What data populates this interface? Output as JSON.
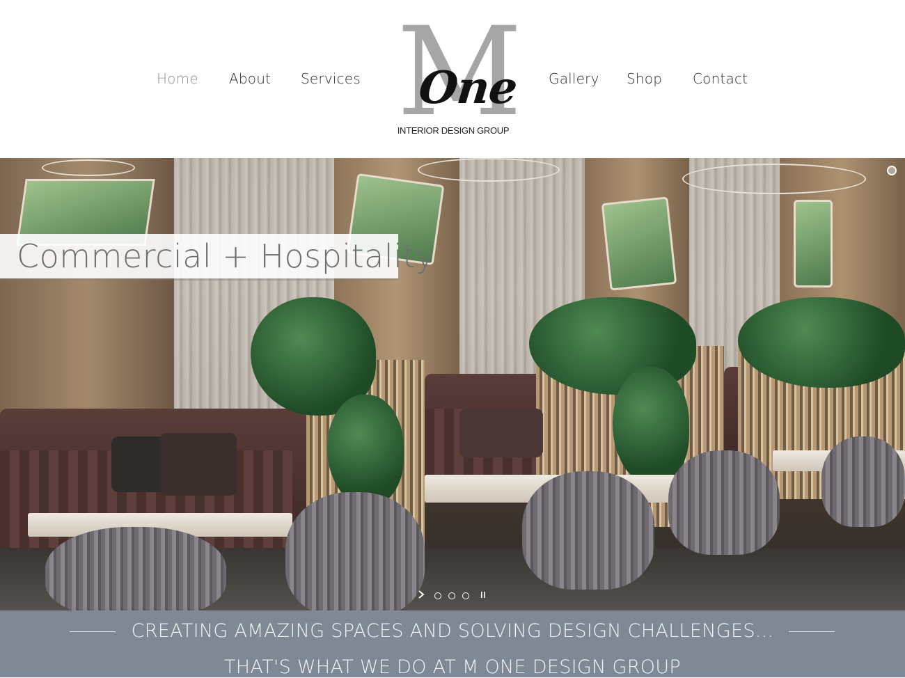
{
  "nav": {
    "left": [
      {
        "label": "Home",
        "active": true
      },
      {
        "label": "About",
        "active": false
      },
      {
        "label": "Services",
        "active": false
      }
    ],
    "right": [
      {
        "label": "Gallery",
        "active": false
      },
      {
        "label": "Shop",
        "active": false
      },
      {
        "label": "Contact",
        "active": false
      }
    ]
  },
  "logo": {
    "letter": "M",
    "word": "One",
    "tagline": "INTERIOR DESIGN GROUP"
  },
  "hero": {
    "caption": "Commercial + Hospitality",
    "slider": {
      "next_icon": "chevron-right-icon",
      "pause_icon": "pause-icon",
      "slide_count": 3
    }
  },
  "banner": {
    "line1": "CREATING AMAZING SPACES AND SOLVING DESIGN CHALLENGES...",
    "line2": "THAT'S WHAT WE DO AT M ONE DESIGN GROUP"
  },
  "colors": {
    "banner_bg": "#7f8995",
    "nav_active": "#8f8f8f",
    "nav_text": "#2b2b2b",
    "logo_gray": "#a6a6a6"
  }
}
